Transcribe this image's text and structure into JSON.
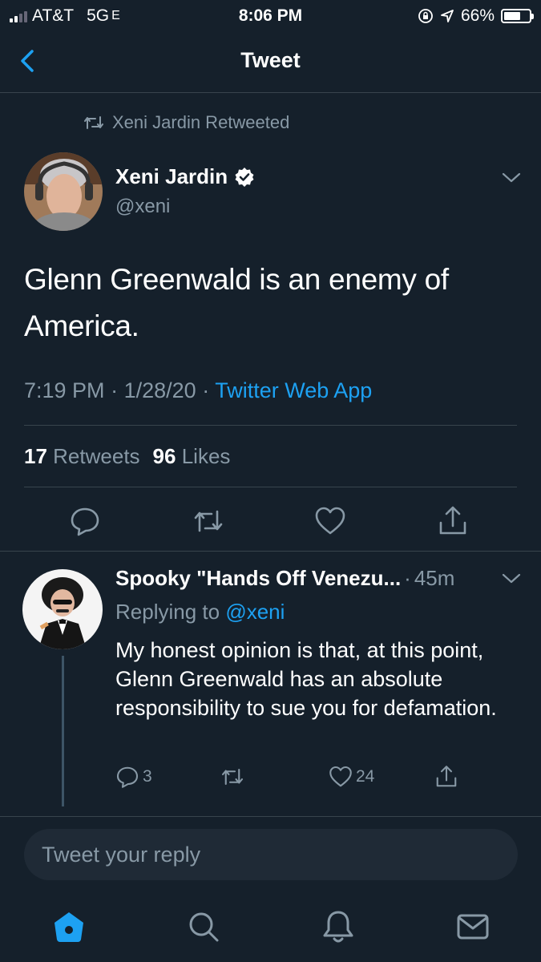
{
  "status_bar": {
    "carrier": "AT&T",
    "network": "5G",
    "network_suffix": "E",
    "time": "8:06 PM",
    "battery": "66%",
    "battery_level": 0.66
  },
  "header": {
    "title": "Tweet"
  },
  "tweet": {
    "retweeted_by": "Xeni Jardin Retweeted",
    "author_name": "Xeni Jardin",
    "author_handle": "@xeni",
    "text": "Glenn Greenwald is an enemy of America.",
    "time": "7:19 PM",
    "date": "1/28/20",
    "separator": "·",
    "source": "Twitter Web App",
    "retweets_count": "17",
    "retweets_label": "Retweets",
    "likes_count": "96",
    "likes_label": "Likes"
  },
  "reply": {
    "author_name": "Spooky \"Hands Off Venezu...",
    "time": "45m",
    "separator": "·",
    "replying_label": "Replying to",
    "replying_handle": "@xeni",
    "text": "My honest opinion is that, at this point, Glenn Greenwald has an absolute responsibility to sue you for defamation.",
    "replies": "3",
    "likes": "24"
  },
  "compose": {
    "placeholder": "Tweet your reply"
  },
  "tab_bar": {
    "items": [
      "home-icon",
      "search-icon",
      "notifications-icon",
      "messages-icon"
    ]
  },
  "colors": {
    "background": "#15202b",
    "accent": "#1da1f2",
    "muted": "#8899a6",
    "divider": "#38444d"
  }
}
